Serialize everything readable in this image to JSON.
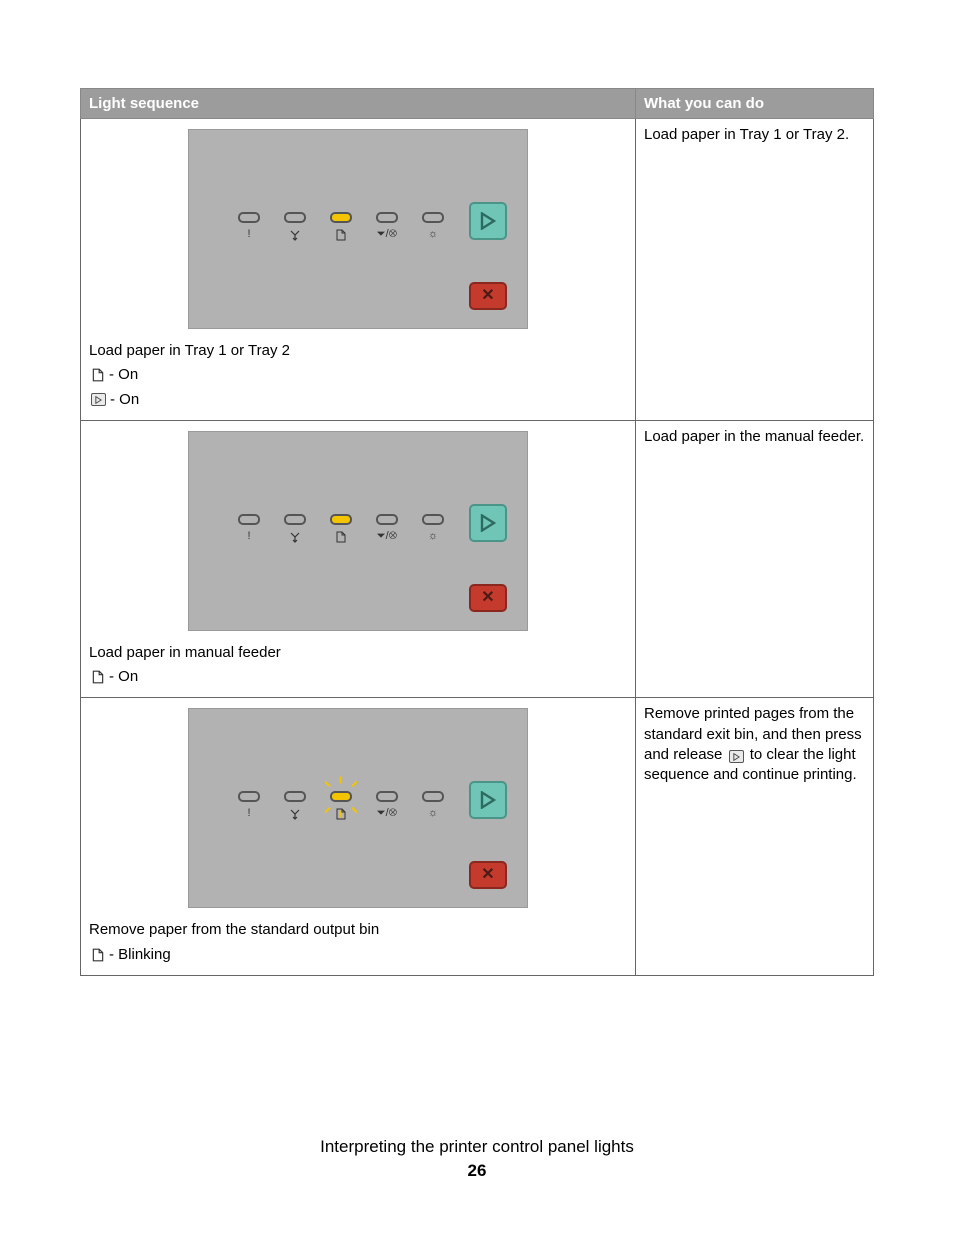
{
  "headers": {
    "light_sequence": "Light sequence",
    "what_you_can_do": "What you can do"
  },
  "rows": [
    {
      "panel": {
        "type": "on"
      },
      "caption": "Load paper in Tray 1 or Tray 2",
      "states": [
        {
          "icon": "paper",
          "text": "- On"
        },
        {
          "icon": "play",
          "text": " - On"
        }
      ],
      "action": "Load paper in Tray 1 or Tray 2."
    },
    {
      "panel": {
        "type": "on"
      },
      "caption": "Load paper in manual feeder",
      "states": [
        {
          "icon": "paper",
          "text": "- On"
        }
      ],
      "action": "Load paper in the manual feeder."
    },
    {
      "panel": {
        "type": "blink"
      },
      "caption": "Remove paper from the standard output bin",
      "states": [
        {
          "icon": "paper",
          "text": "- Blinking"
        }
      ],
      "action_pre": "Remove printed pages from the standard exit bin, and then press and release ",
      "action_post": " to clear the light sequence and continue printing."
    }
  ],
  "panel_icons": {
    "i1": "!",
    "i3_svg": "paper",
    "i4": "⏷/⊗",
    "i5": "☼"
  },
  "footer": {
    "title": "Interpreting the printer control panel lights",
    "page": "26"
  }
}
